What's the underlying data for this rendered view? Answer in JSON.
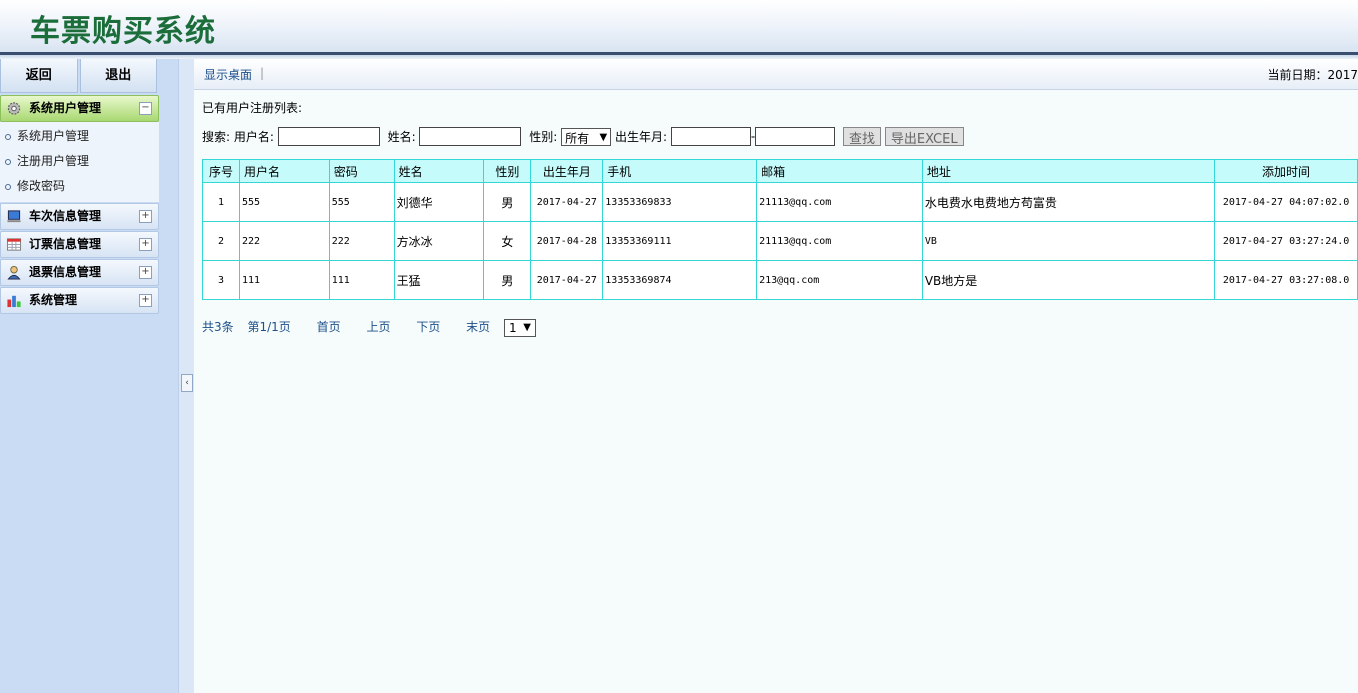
{
  "app": {
    "title": "车票购买系统"
  },
  "sidebar": {
    "back_label": "返回",
    "logout_label": "退出",
    "groups": [
      {
        "label": "系统用户管理",
        "toggle": "−",
        "icon": "gear-icon"
      },
      {
        "label": "车次信息管理",
        "toggle": "+",
        "icon": "monitor-icon"
      },
      {
        "label": "订票信息管理",
        "toggle": "+",
        "icon": "calendar-icon"
      },
      {
        "label": "退票信息管理",
        "toggle": "+",
        "icon": "person-icon"
      },
      {
        "label": "系统管理",
        "toggle": "+",
        "icon": "bar-chart-icon"
      }
    ],
    "sub_items": [
      "系统用户管理",
      "注册用户管理",
      "修改密码"
    ],
    "collapse_glyph": "‹"
  },
  "toolbar": {
    "desktop_label": "显示桌面",
    "separator": "|",
    "date_label": "当前日期：2017"
  },
  "content": {
    "list_title": "已有用户注册列表:",
    "search": {
      "label": "搜索:",
      "username_label": "用户名:",
      "username_value": "",
      "name_label": "姓名:",
      "name_value": "",
      "gender_label": "性别:",
      "gender_selected": "所有",
      "birth_label": "出生年月:",
      "birth_from": "",
      "birth_sep": "-",
      "birth_to": "",
      "find_label": "查找",
      "export_label": "导出EXCEL"
    },
    "table": {
      "headers": [
        "序号",
        "用户名",
        "密码",
        "姓名",
        "性别",
        "出生年月",
        "手机",
        "邮箱",
        "地址",
        "添加时间"
      ],
      "rows": [
        [
          "1",
          "555",
          "555",
          "刘德华",
          "男",
          "2017-04-27",
          "13353369833",
          "21113@qq.com",
          "水电费水电费地方苟富贵",
          "2017-04-27 04:07:02.0"
        ],
        [
          "2",
          "222",
          "222",
          "方冰冰",
          "女",
          "2017-04-28",
          "13353369111",
          "21113@qq.com",
          "VB",
          "2017-04-27 03:27:24.0"
        ],
        [
          "3",
          "111",
          "111",
          "王猛",
          "男",
          "2017-04-27",
          "13353369874",
          "213@qq.com",
          "VB地方是",
          "2017-04-27 03:27:08.0"
        ]
      ]
    },
    "pager": {
      "total": "共3条",
      "page": "第1/1页",
      "first": "首页",
      "prev": "上页",
      "next": "下页",
      "last": "末页",
      "selected": "1"
    }
  },
  "colors": {
    "title_green": "#1b6d3a",
    "table_border": "#35d6d6",
    "table_header": "#c6fbfb",
    "sidebar_bg": "#c9dcf3",
    "active_menu": "#a9d872"
  }
}
